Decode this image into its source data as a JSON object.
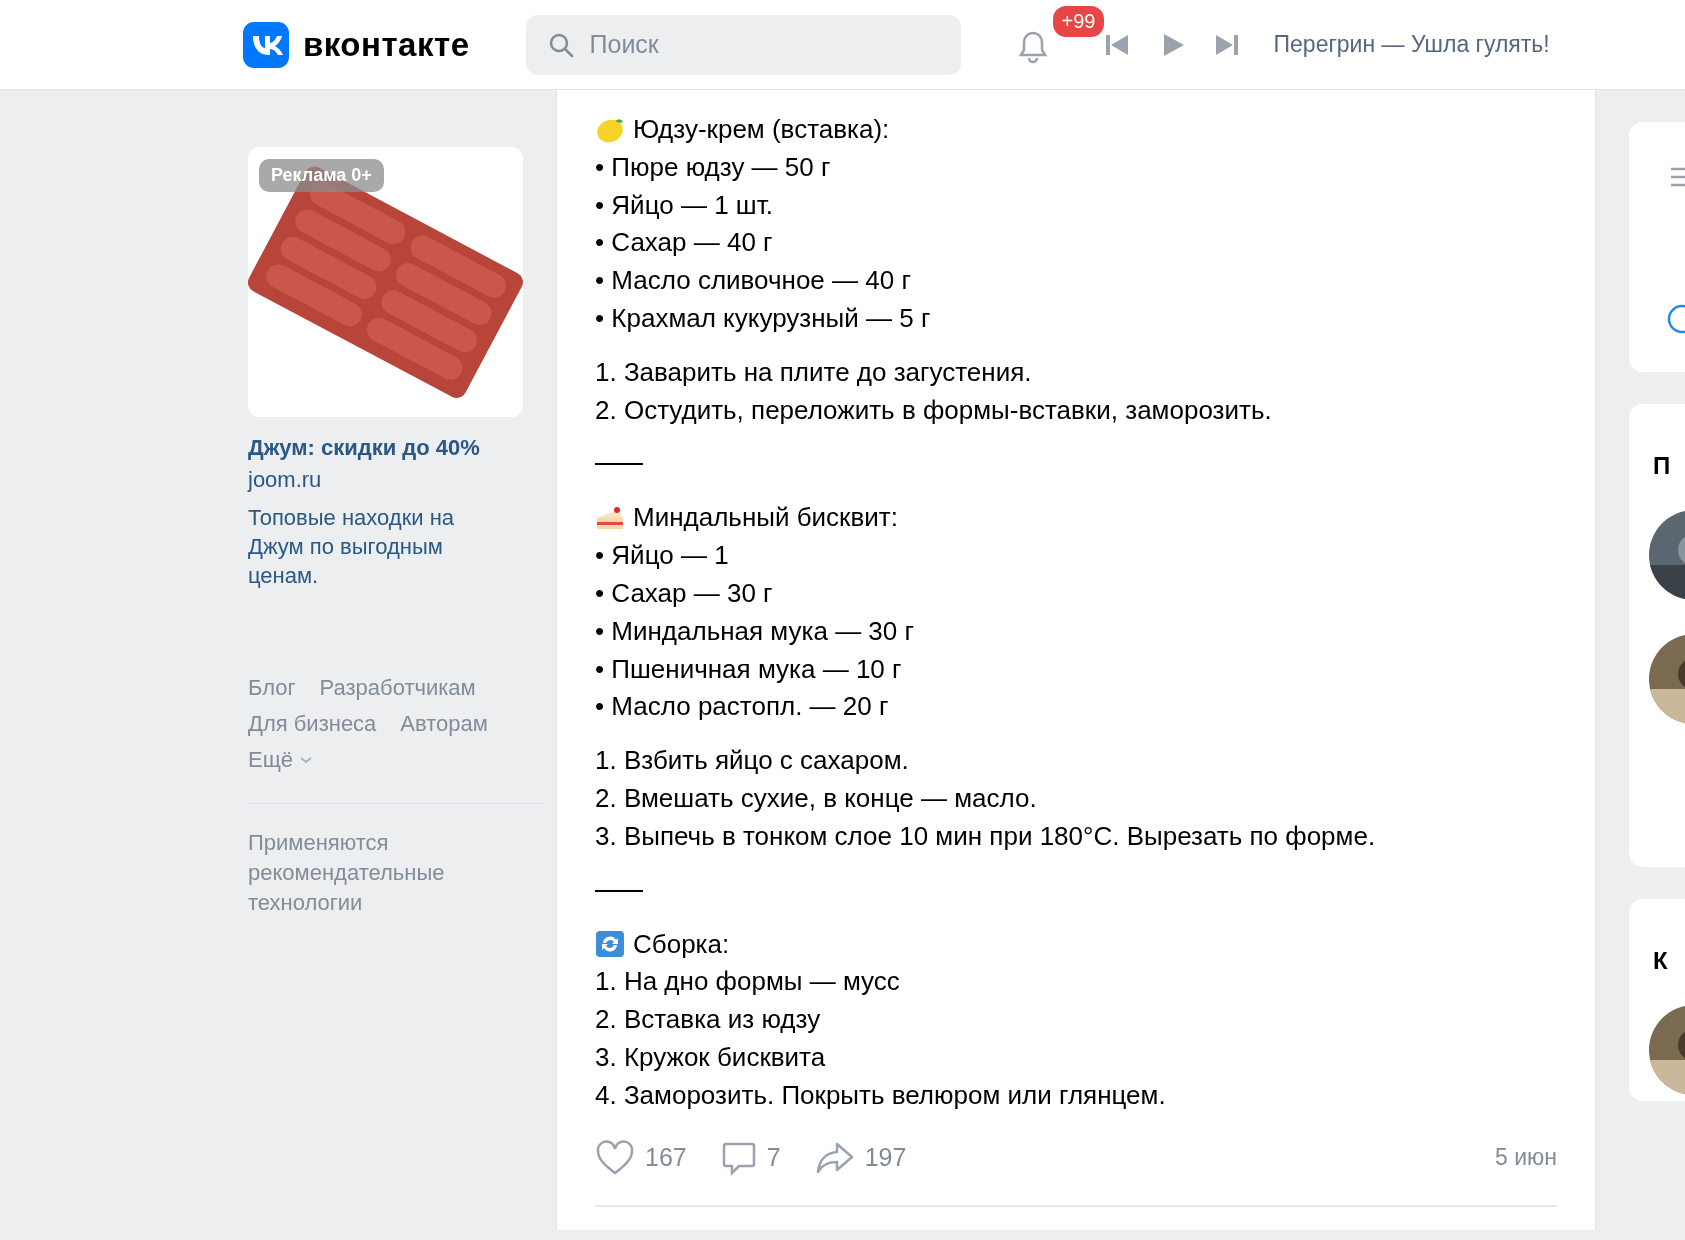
{
  "header": {
    "brand": "вконтакте",
    "search": {
      "placeholder": "Поиск"
    },
    "notifications_badge": "+99",
    "status": "Перегрин — Ушла гулять!"
  },
  "ad": {
    "badge": "Реклама 0+",
    "title": "Джум: скидки до 40%",
    "domain": "joom.ru",
    "description": "Топовые находки на Джум по выгодным ценам."
  },
  "footer_links": [
    "Блог",
    "Разработчикам",
    "Для бизнеса",
    "Авторам"
  ],
  "more_link": "Ещё",
  "footer_note": "Применяются рекомендательные технологии",
  "post": {
    "sections": [
      {
        "kind": "lemon",
        "title": "Юдзу-крем (вставка):",
        "bullets": [
          "• Пюре юдзу — 50 г",
          "• Яйцо — 1 шт.",
          "• Сахар — 40 г",
          "• Масло сливочное — 40 г",
          "• Крахмал кукурузный — 5 г"
        ],
        "steps": [
          "1. Заварить на плите до загустения.",
          "2. Остудить, переложить в формы-вставки, заморозить."
        ]
      },
      {
        "kind": "cake",
        "title": "Миндальный бисквит:",
        "bullets": [
          "• Яйцо — 1",
          "• Сахар — 30 г",
          "• Миндальная мука — 30 г",
          "• Пшеничная мука — 10 г",
          "• Масло растопл. — 20 г"
        ],
        "steps": [
          "1. Взбить яйцо с сахаром.",
          "2. Вмешать сухие, в конце — масло.",
          "3. Выпечь в тонком слое 10 мин при 180°C. Вырезать по форме."
        ]
      },
      {
        "kind": "cycle",
        "title": "Сборка:",
        "steps": [
          "1. На дно формы — мусс",
          "2. Вставка из юдзу",
          "3. Кружок бисквита",
          "4. Заморозить. Покрыть велюром или глянцем."
        ]
      }
    ],
    "likes": "167",
    "comments": "7",
    "shares": "197",
    "date": "5 июн"
  },
  "right_cards": [
    {
      "kind": "menu"
    },
    {
      "kind": "people",
      "heading": "П"
    },
    {
      "kind": "people",
      "heading": "К"
    }
  ]
}
